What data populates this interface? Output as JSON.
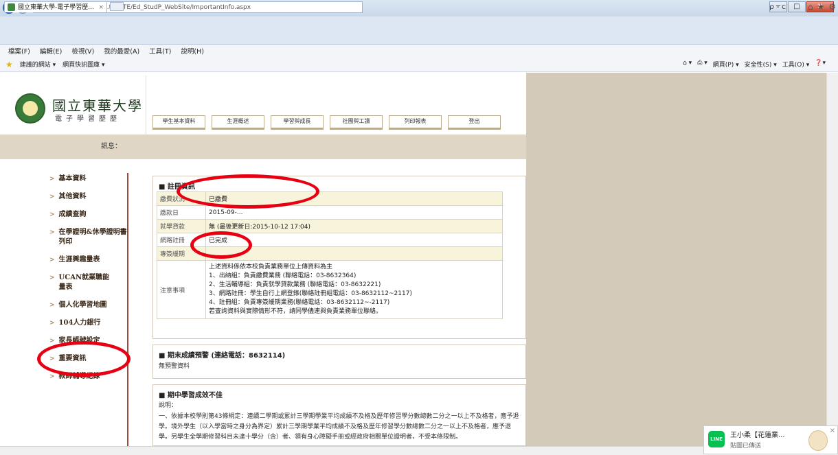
{
  "browser": {
    "url": "http://sys.ndhu.edu.tw/CTE/Ed_StudP_WebSite/ImportantInfo.aspx",
    "tab_title": "國立東華大學-電子學習歷...",
    "tab_close": "×",
    "search_controls": "ρ - c",
    "window_controls": {
      "minimize": "─",
      "maximize": "□",
      "close": "✕"
    },
    "menu": [
      "檔案(F)",
      "編輯(E)",
      "檢視(V)",
      "我的最愛(A)",
      "工具(T)",
      "說明(H)"
    ],
    "favorites": [
      "建議的網站 ▾",
      "網頁快訊圖庫 ▾"
    ],
    "commands": [
      "網頁(P) ▾",
      "安全性(S) ▾",
      "工具(O) ▾"
    ]
  },
  "site": {
    "university": "國立東華大學",
    "system": "電子學習歷歷",
    "nav_tabs": [
      "學生基本資料",
      "生涯概述",
      "學習與成長",
      "社團與工讀",
      "列印報表",
      "登出"
    ],
    "message_label": "訊息："
  },
  "sidebar": {
    "items": [
      "基本資料",
      "其他資料",
      "成績查詢",
      "在學證明&休學證明書列印",
      "生涯興趣量表",
      "UCAN就業職能量表",
      "個人化學習地圖",
      "104人力銀行",
      "家長帳號設定",
      "重要資訊",
      "教師輔導紀錄"
    ]
  },
  "registration": {
    "title": "■ 註冊資訊",
    "rows": [
      {
        "key": "繳費狀況",
        "value": "已繳費"
      },
      {
        "key": "繳款日",
        "value": "2015-09-..."
      },
      {
        "key": "就學貸款",
        "value": "無 (最後更新日:2015-10-12 17:04)"
      },
      {
        "key": "網路註冊",
        "value": "已完成"
      },
      {
        "key": "專簽緩期",
        "value": ""
      }
    ],
    "notes_key": "注意事項",
    "notes": [
      "上述資料係依本校負責業務單位上傳資料為主",
      "1、出納組：負責繳費業務 (聯絡電話：03-8632364)",
      "2、生活輔導組：負責就學貸款業務 (聯絡電話：03-8632221)",
      "3、網路註冊：學生自行上網登錄(聯絡註冊組電話：03-8632112~2117)",
      "4、註冊組：負責專簽緩期業務(聯絡電話：03-8632112~-2117)",
      "若查詢資料與實際情形不符，請同學儘速與負責業務單位聯絡。"
    ]
  },
  "final_warning": {
    "title": "■ 期末成績預警 (連絡電話：8632114)",
    "text": "無預警資料"
  },
  "midterm": {
    "title": "■ 期中學習成效不佳",
    "label": "說明：",
    "text": "一、依據本校學則第43條規定：連續二學期或累計三學期學業平均成績不及格及歷年修習學分數總數二分之一以上不及格者，應予退學。境外學生（以入學當時之身分為界定）累計三學期學業平均成績不及格及歷年修習學分數總數二分之一以上不及格者，應予退學。另學生全學期修習科目未達十學分（含）者、領有身心障礙手冊或經政府相關單位證明者，不受本條限制。"
  },
  "notification": {
    "app": "LINE",
    "name": "王小柔【花蓮業...",
    "message": "貼圖已傳送",
    "close": "×"
  },
  "colors": {
    "accent_band": "#dfd6c6",
    "side_panel": "#d3cab9",
    "highlight_row": "#f8f4dc",
    "annotation_ring": "#e60012",
    "line_green": "#06c152"
  }
}
